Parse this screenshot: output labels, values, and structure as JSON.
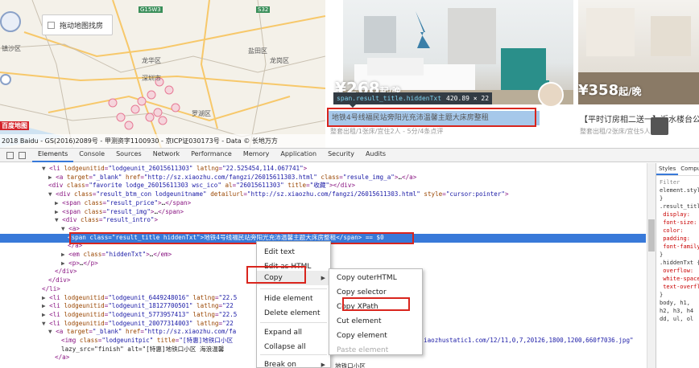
{
  "page": {
    "map": {
      "checkbox_label": "拖动地图找房",
      "labels": [
        {
          "id": "zhenchuo",
          "text": "镇沙区"
        },
        {
          "id": "longhua",
          "text": "龙华区"
        },
        {
          "id": "longgang",
          "text": "龙岗区"
        },
        {
          "id": "yantian",
          "text": "盐田区"
        },
        {
          "id": "luohu",
          "text": "罗湖区"
        },
        {
          "id": "shenzhen",
          "text": "深圳市"
        },
        {
          "id": "g15w3",
          "text": "G15W3"
        },
        {
          "id": "s32",
          "text": "S32"
        }
      ],
      "badge": "百度地图",
      "copyright": "2018 Baidu - GS(2016)2089号 - 甲测资字1100930 - 京ICP证030173号 - Data © 长地万方"
    },
    "card1": {
      "price": "¥268",
      "price_unit": "起/晚",
      "tooltip_selector": "span.result_title.hiddenTxt",
      "tooltip_size": "420.89 × 22",
      "title": "地铁4号线福民站旁阳光充沛温馨主题大床房整租",
      "subtitle": "整套出租/1张床/宜住2人 - 5分/4条点评"
    },
    "card2": {
      "price": "¥358",
      "price_unit": "起/晚",
      "title": "【平时订房相二送一】近水楼台公寓",
      "subtitle": "整套出租/2张床/宜住5人"
    }
  },
  "devtools": {
    "tabs": [
      "Elements",
      "Console",
      "Sources",
      "Network",
      "Performance",
      "Memory",
      "Application",
      "Security",
      "Audits"
    ],
    "active_tab": "Elements",
    "styles_tabs": [
      "Styles",
      "Computed"
    ],
    "styles_filter": "Filter",
    "styles_lines": [
      "element.style {",
      "}",
      ".result_title {",
      "display: ",
      "font-size: ",
      "color: ",
      "padding: ",
      "font-family: ",
      "}",
      ".hiddenTxt {",
      "overflow: ",
      "white-space: ",
      "text-overflow: ",
      "}",
      "body, h1, ",
      "h2, h3, h4",
      "dd, ul, ol"
    ],
    "lines": [
      {
        "indent": 52,
        "tri": "▼",
        "html": "<li lodgeunitid=\"lodgeunit_26015611303\" latlng=\"22.525454,114.067741\">"
      },
      {
        "indent": 60,
        "tri": "▶",
        "html": "<a target=\"_blank\" href=\"http://sz.xiaozhu.com/fangzi/26015611303.html\" class=\"resule_img_a\">…</a>"
      },
      {
        "indent": 60,
        "tri": "",
        "html": "<div class=\"favorite  lodge_26015611303 wsc_ico\" al=\"26015611303\" title=\"收藏\"></div>"
      },
      {
        "indent": 60,
        "tri": "▼",
        "html": "<div class=\"result_btm_con lodgeunitname\" detailurl=\"http://sz.xiaozhu.com/fangzi/26015611303.html\" style=\"cursor:pointer\">"
      },
      {
        "indent": 68,
        "tri": "▶",
        "html": "<span class=\"result_price\">…</span>"
      },
      {
        "indent": 68,
        "tri": "▶",
        "html": "<span class=\"result_img\">…</span>"
      },
      {
        "indent": 68,
        "tri": "▼",
        "html": "<div class=\"result_intro\">"
      },
      {
        "indent": 76,
        "tri": "▼",
        "html": "<a>"
      },
      {
        "indent": 84,
        "tri": "",
        "html": "<span class=\"result_title hiddenTxt\">地铁4号线福民站旁阳光充沛温馨主题大床房整租</span> == $0",
        "selected": true
      },
      {
        "indent": 84,
        "tri": "",
        "html": "</a>"
      },
      {
        "indent": 76,
        "tri": "▶",
        "html": "<em class=\"hiddenTxt\">…</em>"
      },
      {
        "indent": 76,
        "tri": "▶",
        "html": "<p>…</p>"
      },
      {
        "indent": 68,
        "tri": "",
        "html": "</div>"
      },
      {
        "indent": 60,
        "tri": "",
        "html": "</div>"
      },
      {
        "indent": 52,
        "tri": "",
        "html": "</li>"
      },
      {
        "indent": 52,
        "tri": "▶",
        "html": "<li lodgeunitid=\"lodgeunit_6449248016\" latlng=\"22.5"
      },
      {
        "indent": 52,
        "tri": "▶",
        "html": "<li lodgeunitid=\"lodgeunit_18127700501\" latlng=\"22"
      },
      {
        "indent": 52,
        "tri": "▶",
        "html": "<li lodgeunitid=\"lodgeunit_5773957413\" latlng=\"22.5"
      },
      {
        "indent": 52,
        "tri": "▼",
        "html": "<li lodgeunitid=\"lodgeunit_20077314003\" latlng=\"22"
      },
      {
        "indent": 60,
        "tri": "▼",
        "html": "<a target=\"_blank\" href=\"http://sz.xiaozhu.com/fa"
      },
      {
        "indent": 76,
        "tri": "",
        "html": "<img class=\"lodgeunitpic\" title=\"[特惠]地铁口小区"
      },
      {
        "indent": 76,
        "tri": "",
        "html": "lazy_src=\"finish\" alt=\"[特惠]地铁口小区 海浪温馨"
      },
      {
        "indent": 68,
        "tri": "",
        "html": "</a>"
      },
      {
        "indent": 60,
        "tri": "",
        "html": ""
      }
    ],
    "img_src_tail": "iaozhustatic1.com/12/11,0,7,20126,1800,1200,660f7036.jpg\"",
    "context_menu": {
      "items": [
        {
          "label": "Edit text",
          "disabled": false
        },
        {
          "label": "Edit as HTML",
          "disabled": false
        },
        {
          "label": "Copy",
          "disabled": false,
          "submenu": true,
          "active": true
        },
        {
          "label": "Hide element",
          "disabled": false
        },
        {
          "label": "Delete element",
          "disabled": false
        },
        {
          "label": "Expand all",
          "disabled": false
        },
        {
          "label": "Collapse all",
          "disabled": false
        },
        {
          "label": "Break on",
          "disabled": false,
          "submenu": true
        }
      ]
    },
    "copy_submenu": {
      "items": [
        {
          "label": "Copy outerHTML",
          "disabled": false
        },
        {
          "label": "Copy selector",
          "disabled": false
        },
        {
          "label": "Copy XPath",
          "disabled": false
        },
        {
          "label": "Cut element",
          "disabled": false
        },
        {
          "label": "Copy element",
          "disabled": false
        },
        {
          "label": "Paste element",
          "disabled": true
        }
      ]
    },
    "tail_text": "地铁口小区"
  },
  "colors": {
    "accent": "#3879d9",
    "highlight_red": "#d9251d",
    "title_bg": "#a6c8ea"
  }
}
